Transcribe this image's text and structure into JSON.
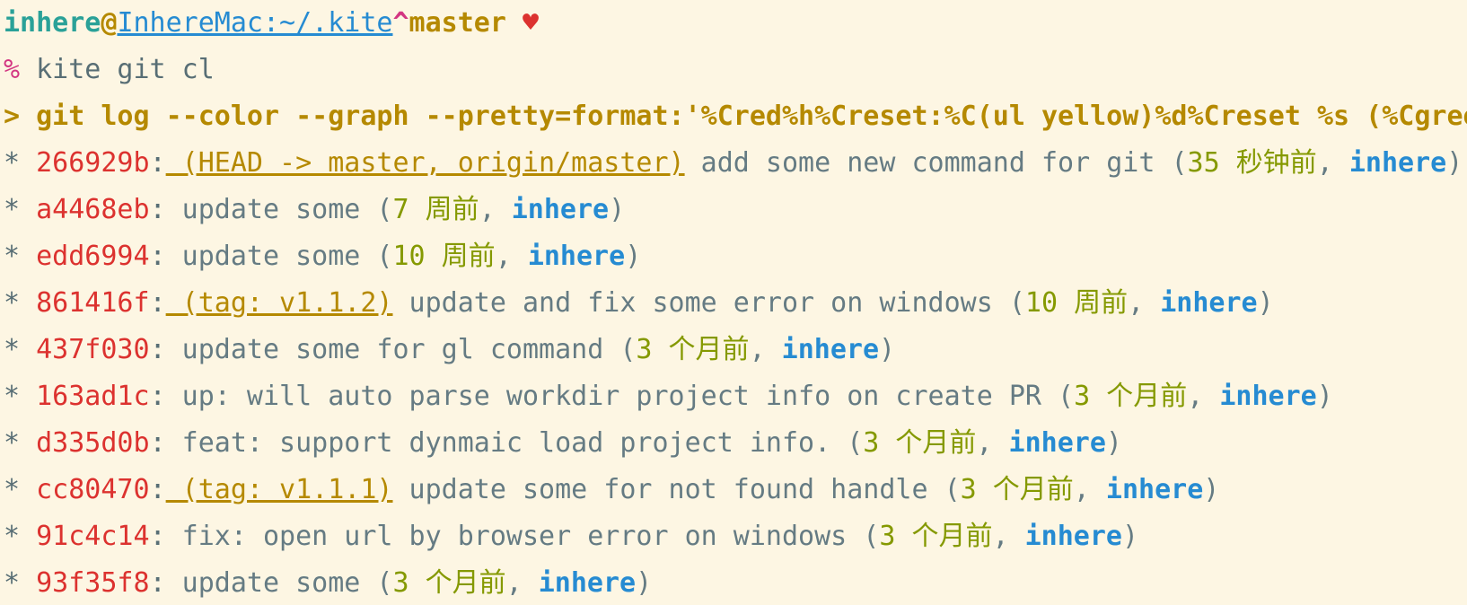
{
  "prompt": {
    "user": "inhere",
    "at": "@",
    "host_path": "InhereMac:~/.kite",
    "caret": "^",
    "branch": "master",
    "heart": "♥"
  },
  "command": {
    "prompt_char": "%",
    "text": " kite git cl"
  },
  "expanded": {
    "text": "> git log --color --graph --pretty=format:'%Cred%h%Creset:%C(ul yellow)%d%Creset %s (%Cgree"
  },
  "log": [
    {
      "star": "* ",
      "hash": "266929b",
      "colon": ":",
      "refs": " (HEAD -> master, origin/master)",
      "subject": " add some new command for git (",
      "time": "35 秒钟前",
      "sep": ", ",
      "author": "inhere",
      "close": ")"
    },
    {
      "star": "* ",
      "hash": "a4468eb",
      "colon": ":",
      "refs": "",
      "subject": " update some (",
      "time": "7 周前",
      "sep": ", ",
      "author": "inhere",
      "close": ")"
    },
    {
      "star": "* ",
      "hash": "edd6994",
      "colon": ":",
      "refs": "",
      "subject": " update some (",
      "time": "10 周前",
      "sep": ", ",
      "author": "inhere",
      "close": ")"
    },
    {
      "star": "* ",
      "hash": "861416f",
      "colon": ":",
      "refs": " (tag: v1.1.2)",
      "subject": " update and fix some error on windows (",
      "time": "10 周前",
      "sep": ", ",
      "author": "inhere",
      "close": ")"
    },
    {
      "star": "* ",
      "hash": "437f030",
      "colon": ":",
      "refs": "",
      "subject": " update some for gl command (",
      "time": "3 个月前",
      "sep": ", ",
      "author": "inhere",
      "close": ")"
    },
    {
      "star": "* ",
      "hash": "163ad1c",
      "colon": ":",
      "refs": "",
      "subject": " up: will auto parse workdir project info on create PR (",
      "time": "3 个月前",
      "sep": ", ",
      "author": "inhere",
      "close": ")"
    },
    {
      "star": "* ",
      "hash": "d335d0b",
      "colon": ":",
      "refs": "",
      "subject": " feat: support dynmaic load project info. (",
      "time": "3 个月前",
      "sep": ", ",
      "author": "inhere",
      "close": ")"
    },
    {
      "star": "* ",
      "hash": "cc80470",
      "colon": ":",
      "refs": " (tag: v1.1.1)",
      "subject": " update some for not found handle (",
      "time": "3 个月前",
      "sep": ", ",
      "author": "inhere",
      "close": ")"
    },
    {
      "star": "* ",
      "hash": "91c4c14",
      "colon": ":",
      "refs": "",
      "subject": " fix: open url by browser error on windows (",
      "time": "3 个月前",
      "sep": ", ",
      "author": "inhere",
      "close": ")"
    },
    {
      "star": "* ",
      "hash": "93f35f8",
      "colon": ":",
      "refs": "",
      "subject": " update some (",
      "time": "3 个月前",
      "sep": ", ",
      "author": "inhere",
      "close": ")"
    }
  ]
}
